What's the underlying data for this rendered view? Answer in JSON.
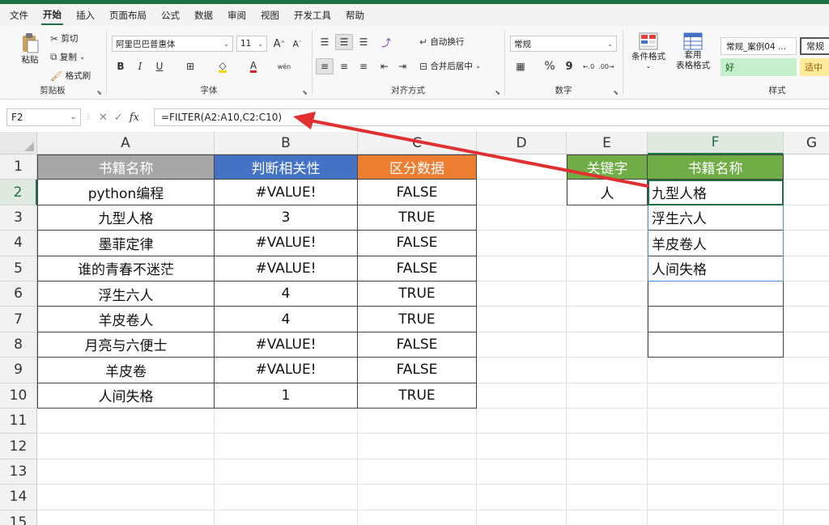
{
  "menu": [
    "文件",
    "开始",
    "插入",
    "页面布局",
    "公式",
    "数据",
    "审阅",
    "视图",
    "开发工具",
    "帮助"
  ],
  "active_menu": "开始",
  "ribbon": {
    "clipboard": {
      "paste": "粘贴",
      "cut": "剪切",
      "copy": "复制",
      "painter": "格式刷",
      "label": "剪贴板"
    },
    "font": {
      "name": "阿里巴巴普惠体",
      "size": "11",
      "grow": "A",
      "shrink": "A",
      "bold": "B",
      "italic": "I",
      "underline": "U",
      "font_color": "A",
      "label": "字体"
    },
    "align": {
      "wrap": "自动换行",
      "merge": "合并后居中",
      "label": "对齐方式"
    },
    "number": {
      "format": "常规",
      "percent": "%",
      "comma": "9",
      "label": "数字"
    },
    "styles": {
      "cond_format": "条件格式",
      "table_format_line1": "套用",
      "table_format_line2": "表格格式",
      "style1": "常规_案例04 ...",
      "style2": "常规",
      "good": "好",
      "neutral": "适中",
      "label": "样式"
    }
  },
  "formula_bar": {
    "name_box": "F2",
    "fx": "fx",
    "formula": "=FILTER(A2:A10,C2:C10)"
  },
  "columns": [
    "A",
    "B",
    "C",
    "D",
    "E",
    "F",
    "G"
  ],
  "rows": [
    "1",
    "2",
    "3",
    "4",
    "5",
    "6",
    "7",
    "8",
    "9",
    "10",
    "11",
    "12",
    "13",
    "14",
    "15"
  ],
  "table_headers": {
    "a": "书籍名称",
    "b": "判断相关性",
    "c": "区分数据"
  },
  "table_rows": [
    {
      "a": "python编程",
      "b": "#VALUE!",
      "c": "FALSE"
    },
    {
      "a": "九型人格",
      "b": "3",
      "c": "TRUE"
    },
    {
      "a": "墨菲定律",
      "b": "#VALUE!",
      "c": "FALSE"
    },
    {
      "a": "谁的青春不迷茫",
      "b": "#VALUE!",
      "c": "FALSE"
    },
    {
      "a": "浮生六人",
      "b": "4",
      "c": "TRUE"
    },
    {
      "a": "羊皮卷人",
      "b": "4",
      "c": "TRUE"
    },
    {
      "a": "月亮与六便士",
      "b": "#VALUE!",
      "c": "FALSE"
    },
    {
      "a": "羊皮卷",
      "b": "#VALUE!",
      "c": "FALSE"
    },
    {
      "a": "人间失格",
      "b": "1",
      "c": "TRUE"
    }
  ],
  "keyword_header": "关键字",
  "keyword_value": "人",
  "result_header": "书籍名称",
  "results": [
    "九型人格",
    "浮生六人",
    "羊皮卷人",
    "人间失格",
    "",
    "",
    ""
  ],
  "colors": {
    "header_gray": "#a6a6a6",
    "header_blue": "#4472c4",
    "header_orange": "#ed7d31",
    "header_green": "#70ad47",
    "excel_green": "#1e7145",
    "arrow_red": "#e03030",
    "good_fill": "#c6efce",
    "neutral_fill": "#ffeb9c"
  }
}
